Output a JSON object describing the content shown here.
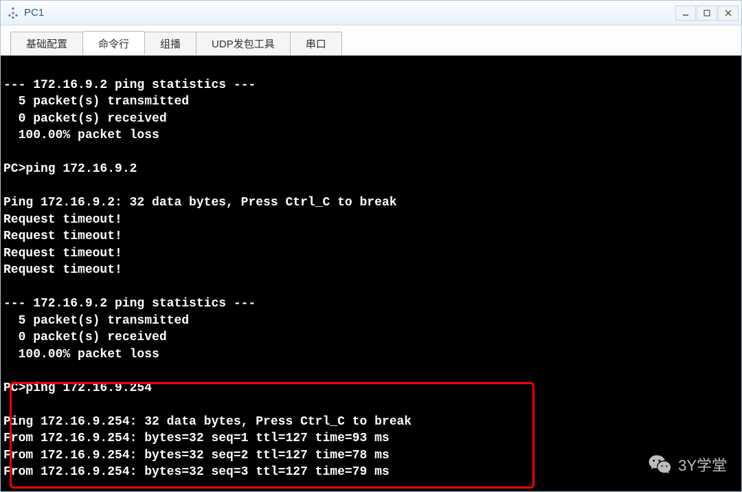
{
  "window": {
    "title": "PC1"
  },
  "tabs": {
    "items": [
      {
        "label": "基础配置",
        "active": false
      },
      {
        "label": "命令行",
        "active": true
      },
      {
        "label": "组播",
        "active": false
      },
      {
        "label": "UDP发包工具",
        "active": false
      },
      {
        "label": "串口",
        "active": false
      }
    ]
  },
  "terminal": {
    "lines": [
      "",
      "--- 172.16.9.2 ping statistics ---",
      "  5 packet(s) transmitted",
      "  0 packet(s) received",
      "  100.00% packet loss",
      "",
      "PC>ping 172.16.9.2",
      "",
      "Ping 172.16.9.2: 32 data bytes, Press Ctrl_C to break",
      "Request timeout!",
      "Request timeout!",
      "Request timeout!",
      "Request timeout!",
      "",
      "--- 172.16.9.2 ping statistics ---",
      "  5 packet(s) transmitted",
      "  0 packet(s) received",
      "  100.00% packet loss",
      "",
      "PC>ping 172.16.9.254",
      "",
      "Ping 172.16.9.254: 32 data bytes, Press Ctrl_C to break",
      "From 172.16.9.254: bytes=32 seq=1 ttl=127 time=93 ms",
      "From 172.16.9.254: bytes=32 seq=2 ttl=127 time=78 ms",
      "From 172.16.9.254: bytes=32 seq=3 ttl=127 time=79 ms"
    ]
  },
  "watermark": {
    "text": "3Y学堂"
  }
}
